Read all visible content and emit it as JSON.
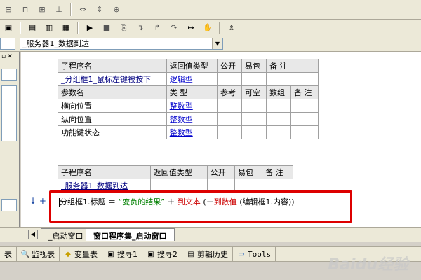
{
  "toolbar": {
    "row1_icons": [
      "align-left-icon",
      "align-center-icon",
      "align-right-icon",
      "align-justify-icon",
      "space-horiz-icon",
      "space-vert-icon",
      "center-both-icon"
    ],
    "row2_icons": [
      "find-icon",
      "layout1-icon",
      "layout2-icon",
      "layout3-icon",
      "run-icon",
      "stop-icon",
      "step-icon",
      "step-into-icon",
      "step-out-icon",
      "step-over-icon",
      "run-to-cursor-icon",
      "hand-icon",
      "debug-icon"
    ]
  },
  "combo": {
    "selected": "_服务器1_数据到达"
  },
  "table1": {
    "header": [
      "子程序名",
      "返回值类型",
      "公开",
      "易包",
      "备 注"
    ],
    "row": {
      "name": "_分组框1_鼠标左键被按下",
      "type": "逻辑型"
    },
    "param_header": [
      "参数名",
      "类 型",
      "参考",
      "可空",
      "数组",
      "备 注"
    ],
    "params": [
      {
        "name": "横向位置",
        "type": "整数型"
      },
      {
        "name": "纵向位置",
        "type": "整数型"
      },
      {
        "name": "功能键状态",
        "type": "整数型"
      }
    ]
  },
  "table2": {
    "header": [
      "子程序名",
      "返回值类型",
      "公开",
      "易包",
      "备 注"
    ],
    "row": {
      "name": "_服务器1_数据到达"
    }
  },
  "code": {
    "arrows": "↓ +",
    "part1": "分组框1.标题 ＝ ",
    "str": "“变负的结果”",
    "part2": " ＋ ",
    "fn1": "到文本",
    "part3": " (－",
    "fn2": "到数值",
    "part4": " (编辑框1.内容))"
  },
  "tabs": [
    {
      "label": "_启动窗口",
      "active": false
    },
    {
      "label": "窗口程序集_启动窗口",
      "active": true
    }
  ],
  "bottom_tabs": [
    {
      "label": "表",
      "icon": "table-icon"
    },
    {
      "label": "监视表",
      "icon": "magnifier-icon"
    },
    {
      "label": "变量表",
      "icon": "variable-icon"
    },
    {
      "label": "搜寻1",
      "icon": "search1-icon"
    },
    {
      "label": "搜寻2",
      "icon": "search2-icon"
    },
    {
      "label": "剪辑历史",
      "icon": "clipboard-icon"
    },
    {
      "label": "Tools",
      "icon": "tools-icon"
    }
  ],
  "watermark": "Baidu经验"
}
